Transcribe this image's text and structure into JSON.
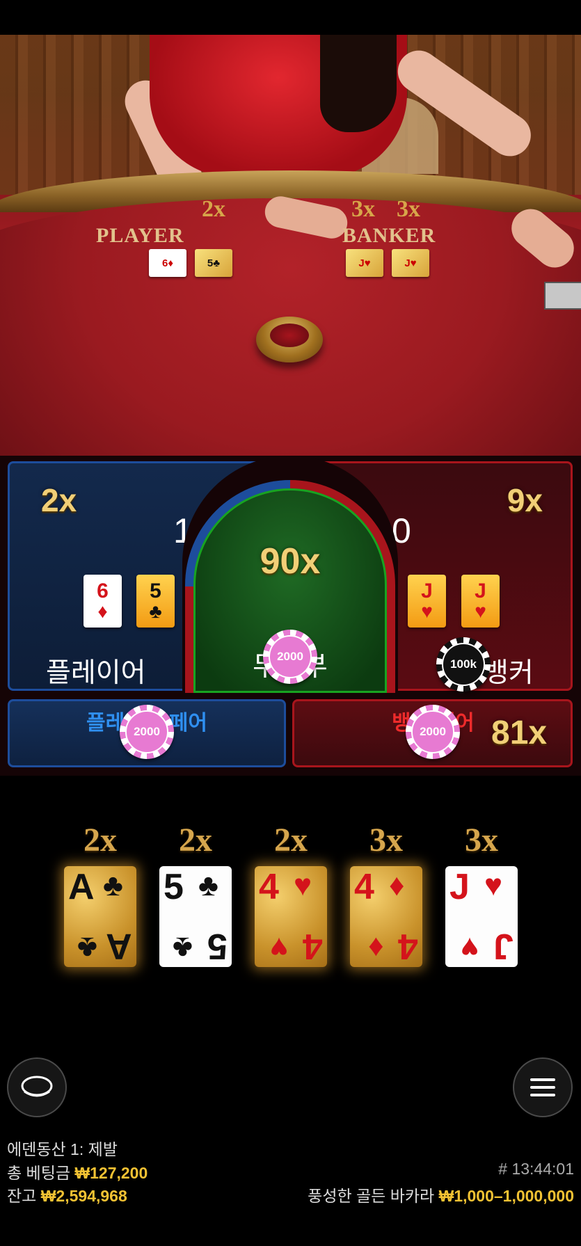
{
  "video": {
    "player": {
      "label": "PLAYER",
      "mult": "2x",
      "cards": [
        "6♦",
        "5♣"
      ]
    },
    "banker": {
      "label": "BANKER",
      "mults": [
        "3x",
        "3x"
      ],
      "cards": [
        "J♥",
        "J♥"
      ]
    }
  },
  "betting": {
    "player": {
      "mult": "2x",
      "score": "1",
      "label": "플레이어",
      "cards": [
        {
          "rank": "6",
          "suit": "♦"
        },
        {
          "rank": "5",
          "suit": "♣"
        }
      ]
    },
    "tie": {
      "mult": "90x",
      "label": "무승부",
      "chip": "2000"
    },
    "banker": {
      "mult": "9x",
      "score": "0",
      "label": "뱅커",
      "chip": "100k",
      "cards": [
        {
          "rank": "J",
          "suit": "♥"
        },
        {
          "rank": "J",
          "suit": "♥"
        }
      ]
    },
    "player_pair": {
      "label": "플레이어 페어",
      "chip": "2000"
    },
    "banker_pair": {
      "label": "뱅커 페어",
      "mult": "81x",
      "chip": "2000"
    }
  },
  "bonus_cards": [
    {
      "mult": "2x",
      "rank": "A",
      "suit": "♣",
      "style": "gold",
      "color": "black"
    },
    {
      "mult": "2x",
      "rank": "5",
      "suit": "♣",
      "style": "white",
      "color": "black"
    },
    {
      "mult": "2x",
      "rank": "4",
      "suit": "♥",
      "style": "gold",
      "color": "red"
    },
    {
      "mult": "3x",
      "rank": "4",
      "suit": "♦",
      "style": "gold",
      "color": "red"
    },
    {
      "mult": "3x",
      "rank": "J",
      "suit": "♥",
      "style": "white",
      "color": "red"
    }
  ],
  "footer": {
    "line1": "에덴동산 1: 제발",
    "total_bet_label": "총 베팅금",
    "total_bet_value": "₩127,200",
    "balance_label": "잔고",
    "balance_value": "₩2,594,968",
    "game_id": "# 13:44:01",
    "table_name": "풍성한 골든 바카라",
    "limits": "₩1,000–1,000,000"
  },
  "colors": {
    "gold": "#f2c233",
    "player_blue": "#1d4d9c",
    "banker_red": "#a8151c",
    "tie_green": "#18a321"
  },
  "icons": {
    "chat": "chat-bubble-icon",
    "menu": "hamburger-menu-icon"
  }
}
